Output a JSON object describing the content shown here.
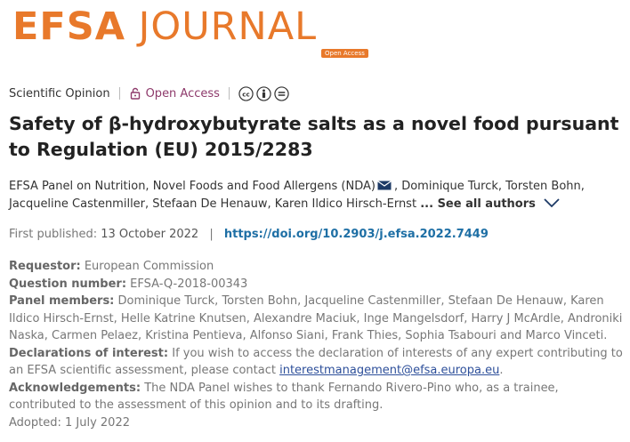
{
  "journal": {
    "logo_bold": "EFSA",
    "logo_light": "JOURNAL",
    "open_access_tag": "Open Access"
  },
  "article_meta": {
    "type": "Scientific Opinion",
    "access": "Open Access",
    "license_icons": [
      "creative-commons-icon",
      "attribution-icon",
      "no-derivatives-icon"
    ]
  },
  "title": "Safety of β-hydroxybutyrate salts as a novel food pursuant to Regulation (EU) 2015/2283",
  "authors": {
    "list": [
      "EFSA Panel on Nutrition, Novel Foods and Food Allergens (NDA)",
      "Dominique Turck",
      "Torsten Bohn",
      "Jacqueline Castenmiller",
      "Stefaan De Henauw",
      "Karen Ildico Hirsch-Ernst"
    ],
    "ellipsis": "...",
    "see_all": "See all authors"
  },
  "publication": {
    "first_published_label": "First published:",
    "date": "13 October 2022",
    "separator": "|",
    "doi": "https://doi.org/10.2903/j.efsa.2022.7449"
  },
  "details": {
    "requestor_label": "Requestor:",
    "requestor": "European Commission",
    "question_label": "Question number:",
    "question": "EFSA-Q-2018-00343",
    "panel_label": "Panel members:",
    "panel": "Dominique Turck, Torsten Bohn, Jacqueline Castenmiller, Stefaan De Henauw, Karen Ildico Hirsch-Ernst, Helle Katrine Knutsen, Alexandre Maciuk, Inge Mangelsdorf, Harry J McArdle, Androniki Naska, Carmen Pelaez, Kristina Pentieva, Alfonso Siani, Frank Thies, Sophia Tsabouri and Marco Vinceti.",
    "declarations_label": "Declarations of interest:",
    "declarations": "If you wish to access the declaration of interests of any expert contributing to an EFSA scientific assessment, please contact",
    "declarations_email": "interestmanagement@efsa.europa.eu",
    "declarations_end": ".",
    "ack_label": "Acknowledgements:",
    "ack": "The NDA Panel wishes to thank Fernando Rivero-Pino who, as a trainee, contributed to the assessment of this opinion and to its drafting.",
    "adopted": "Adopted: 1 July 2022"
  },
  "colors": {
    "brand_orange": "#e8792b",
    "link_blue": "#1e6fa5",
    "oa_purple": "#8e3a6b"
  }
}
